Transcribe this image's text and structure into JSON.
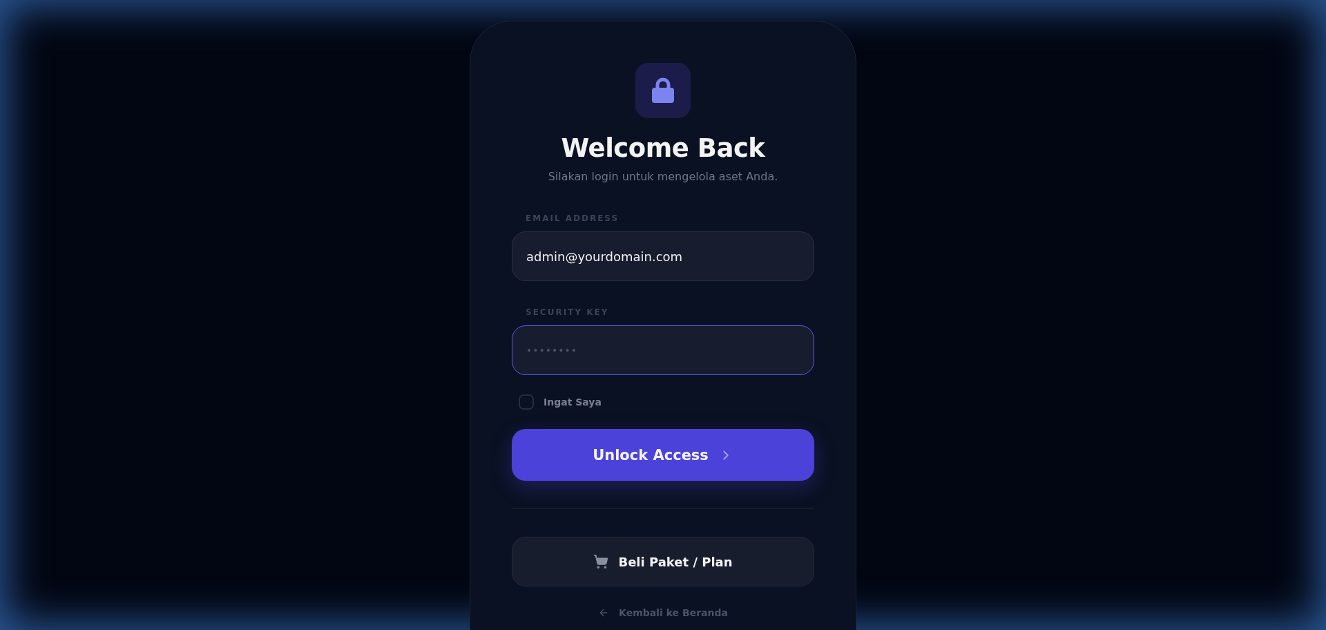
{
  "title": "Welcome Back",
  "subtitle": "Silakan login untuk mengelola aset Anda.",
  "fields": [
    {
      "label": "EMAIL ADDRESS",
      "kind": "email",
      "value": "admin@yourdomain.com",
      "focused": false
    },
    {
      "label": "SECURITY KEY",
      "kind": "password",
      "placeholder": "••••••••",
      "focused": true
    }
  ],
  "remember": {
    "label": "Ingat Saya",
    "checked": false
  },
  "submit": {
    "label": "Unlock Access"
  },
  "plan_button": {
    "label": "Beli Paket / Plan"
  },
  "back_link": {
    "label": "Kembali ke Beranda"
  }
}
